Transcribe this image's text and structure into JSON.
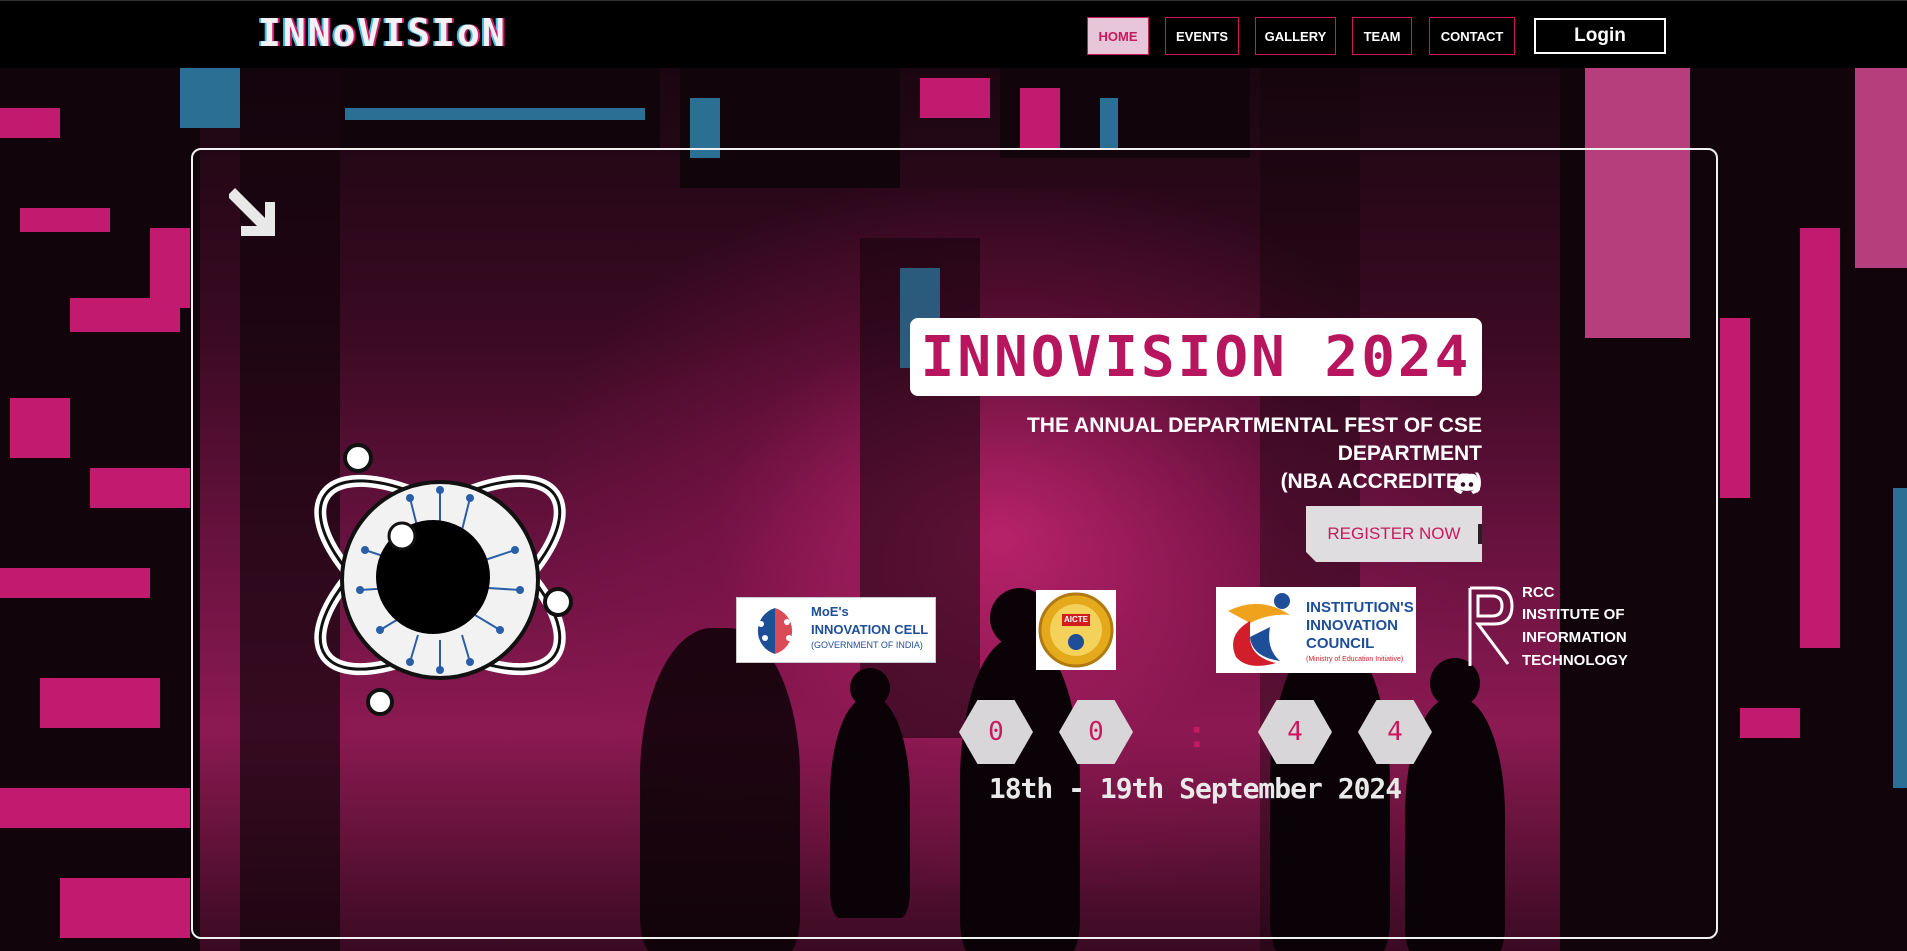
{
  "header": {
    "logo": "INNoVISIoN",
    "nav": [
      {
        "label": "HOME",
        "active": true
      },
      {
        "label": "EVENTS",
        "active": false
      },
      {
        "label": "GALLERY",
        "active": false
      },
      {
        "label": "TEAM",
        "active": false
      },
      {
        "label": "CONTACT",
        "active": false
      }
    ],
    "login_label": "Login"
  },
  "hero": {
    "title": "INNOVISION 2024",
    "subtitle_line1": "THE ANNUAL DEPARTMENTAL FEST OF CSE DEPARTMENT",
    "subtitle_line2": "(NBA ACCREDITED)",
    "register_label": "REGISTER NOW",
    "countdown": [
      "0",
      "0",
      "4",
      "4"
    ],
    "countdown_separator": ":",
    "date": "18th - 19th September 2024"
  },
  "logos": {
    "moe": {
      "line1": "MoE's",
      "line2": "INNOVATION CELL",
      "line3": "(GOVERNMENT OF INDIA)"
    },
    "aicte": {
      "label": "AICTE"
    },
    "iic": {
      "line1": "INSTITUTION'S",
      "line2": "INNOVATION",
      "line3": "COUNCIL",
      "line4": "(Ministry of Education Initiative)"
    },
    "rcc": {
      "line1": "RCC",
      "line2": "INSTITUTE OF",
      "line3": "INFORMATION",
      "line4": "TECHNOLOGY"
    }
  },
  "icons": {
    "discord": "discord-icon",
    "arrow": "arrow-down-right-icon",
    "emblem": "atom-circuit-eye-emblem"
  },
  "colors": {
    "accent": "#c8195f",
    "title_text": "#b8155f",
    "background": "#000000",
    "card_border": "#f1f1f1"
  }
}
